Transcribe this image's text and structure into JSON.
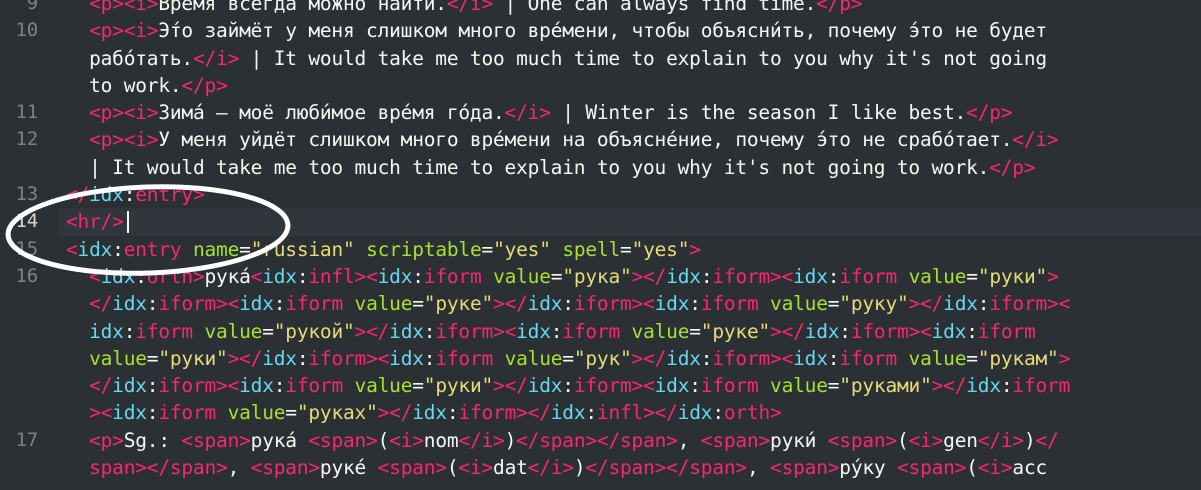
{
  "editor": {
    "gutter": [
      "9",
      "10",
      "",
      "",
      "11",
      "12",
      "",
      "13",
      "14",
      "15",
      "16",
      "",
      "",
      "",
      "",
      "",
      "17",
      ""
    ],
    "active_line": "14",
    "lines": [
      [
        {
          "c": "tag",
          "t": "  <p><i>"
        },
        {
          "c": "txt",
          "t": "Вре́мя всегда можно найти́."
        },
        {
          "c": "tag",
          "t": "</i>"
        },
        {
          "c": "txt",
          "t": " | One can always find time."
        },
        {
          "c": "tag",
          "t": "</p>"
        }
      ],
      [
        {
          "c": "tag",
          "t": "  <p><i>"
        },
        {
          "c": "txt",
          "t": "Э́то займёт у меня слишком много вре́мени, чтобы объясни́ть, почему э́то не будет"
        }
      ],
      [
        {
          "c": "txt",
          "t": "  рабо́тать."
        },
        {
          "c": "tag",
          "t": "</i>"
        },
        {
          "c": "txt",
          "t": " | It would take me too much time to explain to you why it's not going"
        }
      ],
      [
        {
          "c": "txt",
          "t": "  to work."
        },
        {
          "c": "tag",
          "t": "</p>"
        }
      ],
      [
        {
          "c": "tag",
          "t": "  <p><i>"
        },
        {
          "c": "txt",
          "t": "Зима́ — моё люби́мое вре́мя го́да."
        },
        {
          "c": "tag",
          "t": "</i>"
        },
        {
          "c": "txt",
          "t": " | Winter is the season I like best."
        },
        {
          "c": "tag",
          "t": "</p>"
        }
      ],
      [
        {
          "c": "tag",
          "t": "  <p><i>"
        },
        {
          "c": "txt",
          "t": "У меня уйдёт слишком много вре́мени на объясне́ние, почему э́то не срабо́тает."
        },
        {
          "c": "tag",
          "t": "</i>"
        }
      ],
      [
        {
          "c": "txt",
          "t": "  | It would take me too much time to explain to you why it's not going to work."
        },
        {
          "c": "tag",
          "t": "</p>"
        }
      ],
      [
        {
          "c": "tag",
          "t": "</"
        },
        {
          "c": "ns",
          "t": "idx"
        },
        {
          "c": "txt",
          "t": ":"
        },
        {
          "c": "tag",
          "t": "entry>"
        }
      ],
      [
        {
          "c": "tag",
          "t": "<hr/>"
        }
      ],
      [
        {
          "c": "tag",
          "t": "<"
        },
        {
          "c": "ns",
          "t": "idx"
        },
        {
          "c": "txt",
          "t": ":"
        },
        {
          "c": "tag",
          "t": "entry "
        },
        {
          "c": "an",
          "t": "name"
        },
        {
          "c": "txt",
          "t": "="
        },
        {
          "c": "str",
          "t": "\"russian\""
        },
        {
          "c": "txt",
          "t": " "
        },
        {
          "c": "an",
          "t": "scriptable"
        },
        {
          "c": "txt",
          "t": "="
        },
        {
          "c": "str",
          "t": "\"yes\""
        },
        {
          "c": "txt",
          "t": " "
        },
        {
          "c": "an",
          "t": "spell"
        },
        {
          "c": "txt",
          "t": "="
        },
        {
          "c": "str",
          "t": "\"yes\""
        },
        {
          "c": "tag",
          "t": ">"
        }
      ],
      [
        {
          "c": "tag",
          "t": "  <"
        },
        {
          "c": "ns",
          "t": "idx"
        },
        {
          "c": "txt",
          "t": ":"
        },
        {
          "c": "tag",
          "t": "orth>"
        },
        {
          "c": "txt",
          "t": "рука́"
        },
        {
          "c": "tag",
          "t": "<"
        },
        {
          "c": "ns",
          "t": "idx"
        },
        {
          "c": "txt",
          "t": ":"
        },
        {
          "c": "tag",
          "t": "infl><"
        },
        {
          "c": "ns",
          "t": "idx"
        },
        {
          "c": "txt",
          "t": ":"
        },
        {
          "c": "tag",
          "t": "iform "
        },
        {
          "c": "an",
          "t": "value"
        },
        {
          "c": "txt",
          "t": "="
        },
        {
          "c": "str",
          "t": "\"рука\""
        },
        {
          "c": "tag",
          "t": "></"
        },
        {
          "c": "ns",
          "t": "idx"
        },
        {
          "c": "txt",
          "t": ":"
        },
        {
          "c": "tag",
          "t": "iform><"
        },
        {
          "c": "ns",
          "t": "idx"
        },
        {
          "c": "txt",
          "t": ":"
        },
        {
          "c": "tag",
          "t": "iform "
        },
        {
          "c": "an",
          "t": "value"
        },
        {
          "c": "txt",
          "t": "="
        },
        {
          "c": "str",
          "t": "\"руки\""
        },
        {
          "c": "tag",
          "t": ">"
        }
      ],
      [
        {
          "c": "tag",
          "t": "  </"
        },
        {
          "c": "ns",
          "t": "idx"
        },
        {
          "c": "txt",
          "t": ":"
        },
        {
          "c": "tag",
          "t": "iform><"
        },
        {
          "c": "ns",
          "t": "idx"
        },
        {
          "c": "txt",
          "t": ":"
        },
        {
          "c": "tag",
          "t": "iform "
        },
        {
          "c": "an",
          "t": "value"
        },
        {
          "c": "txt",
          "t": "="
        },
        {
          "c": "str",
          "t": "\"руке\""
        },
        {
          "c": "tag",
          "t": "></"
        },
        {
          "c": "ns",
          "t": "idx"
        },
        {
          "c": "txt",
          "t": ":"
        },
        {
          "c": "tag",
          "t": "iform><"
        },
        {
          "c": "ns",
          "t": "idx"
        },
        {
          "c": "txt",
          "t": ":"
        },
        {
          "c": "tag",
          "t": "iform "
        },
        {
          "c": "an",
          "t": "value"
        },
        {
          "c": "txt",
          "t": "="
        },
        {
          "c": "str",
          "t": "\"руку\""
        },
        {
          "c": "tag",
          "t": "></"
        },
        {
          "c": "ns",
          "t": "idx"
        },
        {
          "c": "txt",
          "t": ":"
        },
        {
          "c": "tag",
          "t": "iform><"
        }
      ],
      [
        {
          "c": "txt",
          "t": "  "
        },
        {
          "c": "ns",
          "t": "idx"
        },
        {
          "c": "txt",
          "t": ":"
        },
        {
          "c": "tag",
          "t": "iform "
        },
        {
          "c": "an",
          "t": "value"
        },
        {
          "c": "txt",
          "t": "="
        },
        {
          "c": "str",
          "t": "\"рукой\""
        },
        {
          "c": "tag",
          "t": "></"
        },
        {
          "c": "ns",
          "t": "idx"
        },
        {
          "c": "txt",
          "t": ":"
        },
        {
          "c": "tag",
          "t": "iform><"
        },
        {
          "c": "ns",
          "t": "idx"
        },
        {
          "c": "txt",
          "t": ":"
        },
        {
          "c": "tag",
          "t": "iform "
        },
        {
          "c": "an",
          "t": "value"
        },
        {
          "c": "txt",
          "t": "="
        },
        {
          "c": "str",
          "t": "\"руке\""
        },
        {
          "c": "tag",
          "t": "></"
        },
        {
          "c": "ns",
          "t": "idx"
        },
        {
          "c": "txt",
          "t": ":"
        },
        {
          "c": "tag",
          "t": "iform><"
        },
        {
          "c": "ns",
          "t": "idx"
        },
        {
          "c": "txt",
          "t": ":"
        },
        {
          "c": "tag",
          "t": "iform"
        }
      ],
      [
        {
          "c": "txt",
          "t": "  "
        },
        {
          "c": "an",
          "t": "value"
        },
        {
          "c": "txt",
          "t": "="
        },
        {
          "c": "str",
          "t": "\"руки\""
        },
        {
          "c": "tag",
          "t": "></"
        },
        {
          "c": "ns",
          "t": "idx"
        },
        {
          "c": "txt",
          "t": ":"
        },
        {
          "c": "tag",
          "t": "iform><"
        },
        {
          "c": "ns",
          "t": "idx"
        },
        {
          "c": "txt",
          "t": ":"
        },
        {
          "c": "tag",
          "t": "iform "
        },
        {
          "c": "an",
          "t": "value"
        },
        {
          "c": "txt",
          "t": "="
        },
        {
          "c": "str",
          "t": "\"рук\""
        },
        {
          "c": "tag",
          "t": "></"
        },
        {
          "c": "ns",
          "t": "idx"
        },
        {
          "c": "txt",
          "t": ":"
        },
        {
          "c": "tag",
          "t": "iform><"
        },
        {
          "c": "ns",
          "t": "idx"
        },
        {
          "c": "txt",
          "t": ":"
        },
        {
          "c": "tag",
          "t": "iform "
        },
        {
          "c": "an",
          "t": "value"
        },
        {
          "c": "txt",
          "t": "="
        },
        {
          "c": "str",
          "t": "\"рукам\""
        },
        {
          "c": "tag",
          "t": ">"
        }
      ],
      [
        {
          "c": "tag",
          "t": "  </"
        },
        {
          "c": "ns",
          "t": "idx"
        },
        {
          "c": "txt",
          "t": ":"
        },
        {
          "c": "tag",
          "t": "iform><"
        },
        {
          "c": "ns",
          "t": "idx"
        },
        {
          "c": "txt",
          "t": ":"
        },
        {
          "c": "tag",
          "t": "iform "
        },
        {
          "c": "an",
          "t": "value"
        },
        {
          "c": "txt",
          "t": "="
        },
        {
          "c": "str",
          "t": "\"руки\""
        },
        {
          "c": "tag",
          "t": "></"
        },
        {
          "c": "ns",
          "t": "idx"
        },
        {
          "c": "txt",
          "t": ":"
        },
        {
          "c": "tag",
          "t": "iform><"
        },
        {
          "c": "ns",
          "t": "idx"
        },
        {
          "c": "txt",
          "t": ":"
        },
        {
          "c": "tag",
          "t": "iform "
        },
        {
          "c": "an",
          "t": "value"
        },
        {
          "c": "txt",
          "t": "="
        },
        {
          "c": "str",
          "t": "\"руками\""
        },
        {
          "c": "tag",
          "t": "></"
        },
        {
          "c": "ns",
          "t": "idx"
        },
        {
          "c": "txt",
          "t": ":"
        },
        {
          "c": "tag",
          "t": "iform"
        }
      ],
      [
        {
          "c": "tag",
          "t": "  ><"
        },
        {
          "c": "ns",
          "t": "idx"
        },
        {
          "c": "txt",
          "t": ":"
        },
        {
          "c": "tag",
          "t": "iform "
        },
        {
          "c": "an",
          "t": "value"
        },
        {
          "c": "txt",
          "t": "="
        },
        {
          "c": "str",
          "t": "\"руках\""
        },
        {
          "c": "tag",
          "t": "></"
        },
        {
          "c": "ns",
          "t": "idx"
        },
        {
          "c": "txt",
          "t": ":"
        },
        {
          "c": "tag",
          "t": "iform></"
        },
        {
          "c": "ns",
          "t": "idx"
        },
        {
          "c": "txt",
          "t": ":"
        },
        {
          "c": "tag",
          "t": "infl></"
        },
        {
          "c": "ns",
          "t": "idx"
        },
        {
          "c": "txt",
          "t": ":"
        },
        {
          "c": "tag",
          "t": "orth>"
        }
      ],
      [
        {
          "c": "tag",
          "t": "  <p>"
        },
        {
          "c": "txt",
          "t": "Sg.: "
        },
        {
          "c": "tag",
          "t": "<span>"
        },
        {
          "c": "txt",
          "t": "рука́ "
        },
        {
          "c": "tag",
          "t": "<span>"
        },
        {
          "c": "txt",
          "t": "("
        },
        {
          "c": "tag",
          "t": "<i>"
        },
        {
          "c": "txt",
          "t": "nom"
        },
        {
          "c": "tag",
          "t": "</i>"
        },
        {
          "c": "txt",
          "t": ")"
        },
        {
          "c": "tag",
          "t": "</span></span>"
        },
        {
          "c": "txt",
          "t": ", "
        },
        {
          "c": "tag",
          "t": "<span>"
        },
        {
          "c": "txt",
          "t": "руки́ "
        },
        {
          "c": "tag",
          "t": "<span>"
        },
        {
          "c": "txt",
          "t": "("
        },
        {
          "c": "tag",
          "t": "<i>"
        },
        {
          "c": "txt",
          "t": "gen"
        },
        {
          "c": "tag",
          "t": "</i>"
        },
        {
          "c": "txt",
          "t": ")"
        },
        {
          "c": "tag",
          "t": "</"
        }
      ],
      [
        {
          "c": "tag",
          "t": "  span></span>"
        },
        {
          "c": "txt",
          "t": ", "
        },
        {
          "c": "tag",
          "t": "<span>"
        },
        {
          "c": "txt",
          "t": "руке́ "
        },
        {
          "c": "tag",
          "t": "<span>"
        },
        {
          "c": "txt",
          "t": "("
        },
        {
          "c": "tag",
          "t": "<i>"
        },
        {
          "c": "txt",
          "t": "dat"
        },
        {
          "c": "tag",
          "t": "</i>"
        },
        {
          "c": "txt",
          "t": ")"
        },
        {
          "c": "tag",
          "t": "</span></span>"
        },
        {
          "c": "txt",
          "t": ", "
        },
        {
          "c": "tag",
          "t": "<span>"
        },
        {
          "c": "txt",
          "t": "ру́ку "
        },
        {
          "c": "tag",
          "t": "<span>"
        },
        {
          "c": "txt",
          "t": "("
        },
        {
          "c": "tag",
          "t": "<i>"
        },
        {
          "c": "txt",
          "t": "acc"
        }
      ]
    ]
  },
  "colors": {
    "background": "#2b3035",
    "tag": "#f92672",
    "attribute": "#a6e22e",
    "namespace": "#66d9ef",
    "string": "#e6db74",
    "text": "#f8f8f2",
    "annotation": "#ffffff"
  }
}
